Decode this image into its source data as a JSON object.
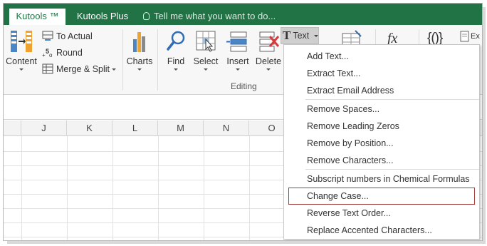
{
  "tabs": {
    "kutools": "Kutools ™",
    "kutools_plus": "Kutools Plus",
    "tell_me": "Tell me what you want to do..."
  },
  "ribbon": {
    "content": "Content",
    "to_actual": "To Actual",
    "round": "Round",
    "merge_split": "Merge & Split",
    "charts": "Charts",
    "find": "Find",
    "select": "Select",
    "insert": "Insert",
    "delete": "Delete",
    "text": "Text",
    "editing_label": "Editing",
    "fx": "fx",
    "braces": "{()}",
    "ex_partial": "Ex"
  },
  "columns": [
    "J",
    "K",
    "L",
    "M",
    "N",
    "O"
  ],
  "text_menu": {
    "items": [
      "Add Text...",
      "Extract Text...",
      "Extract Email Address",
      "Remove Spaces...",
      "Remove Leading Zeros",
      "Remove by Position...",
      "Remove Characters...",
      "Subscript numbers in Chemical Formulas",
      "Change Case...",
      "Reverse Text Order...",
      "Replace Accented Characters..."
    ],
    "highlighted": "Change Case..."
  },
  "colors": {
    "tab_bar": "#217346",
    "highlight_border": "#9e3c3c"
  }
}
